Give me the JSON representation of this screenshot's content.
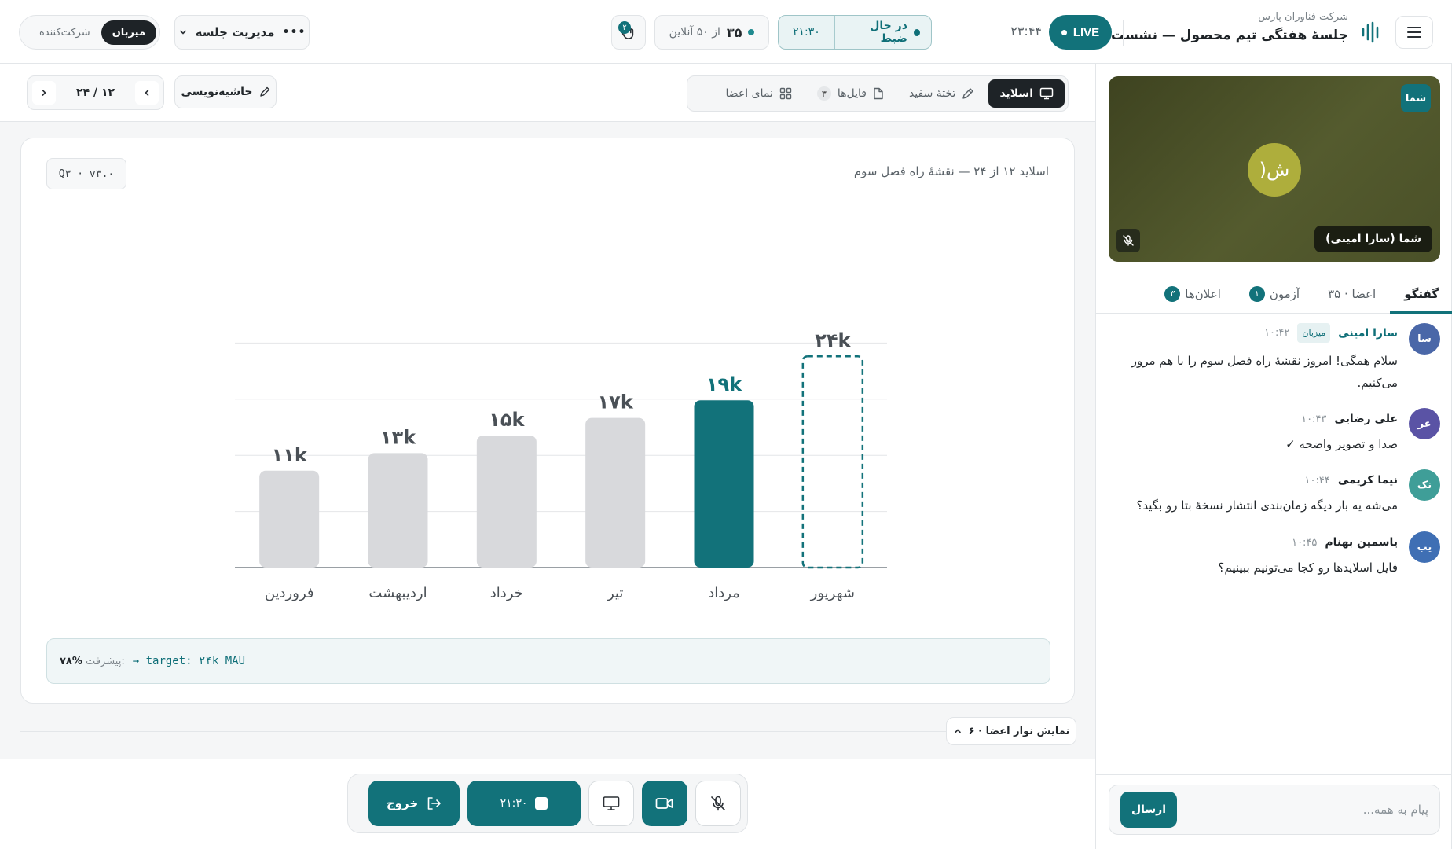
{
  "header": {
    "org": "شرکت فناوران پارس",
    "title": "جلسهٔ هفتگی تیم محصول — نشست ۸",
    "live_label": "LIVE",
    "clock": "۲۳:۴۴",
    "recording_label": "در حال ضبط",
    "recording_time": "۲۱:۳۰",
    "online_count": "۳۵",
    "online_suffix": "از ۵۰ آنلاین",
    "hand_count": "۲",
    "manage_label": "مدیریت جلسه",
    "role_active": "میزبان",
    "role_other": "شرکت‌کننده"
  },
  "toolbar": {
    "tabs": [
      {
        "label": "اسلاید",
        "icon": "monitor-icon",
        "active": true
      },
      {
        "label": "تختهٔ سفید",
        "icon": "pen-icon",
        "active": false
      },
      {
        "label": "فایل‌ها",
        "icon": "file-icon",
        "count": "۳",
        "active": false
      },
      {
        "label": "نمای اعضا",
        "icon": "grid-icon",
        "active": false
      }
    ],
    "annotate_label": "حاشیه‌نویسی",
    "page_indicator": "۱۲ / ۲۴"
  },
  "slide": {
    "caption": "اسلاید ۱۲ از ۲۴ — نقشهٔ راه فصل سوم",
    "version_tag": "Q۳ · v۳.۰",
    "progress_label": "پیشرفت:",
    "progress_value": "۷۸%",
    "code_text": "→ target: ۲۴k MAU"
  },
  "chart_data": {
    "type": "bar",
    "categories": [
      "فروردین",
      "اردیبهشت",
      "خرداد",
      "تیر",
      "مرداد",
      "شهریور"
    ],
    "values": [
      11,
      13,
      15,
      17,
      19,
      24
    ],
    "labels": [
      "۱۱k",
      "۱۳k",
      "۱۵k",
      "۱۷k",
      "۱۹k",
      "۲۴k"
    ],
    "highlight_index": 4,
    "target_index": 5,
    "ylim": [
      0,
      30
    ],
    "grid": true,
    "colors": {
      "bar": "#d8d9dc",
      "highlight": "#12727a",
      "label": "#4a5056",
      "target": "#12727a"
    }
  },
  "members_strip_label": "نمایش نوار اعضا · ۶",
  "controls": {
    "leave_label": "خروج",
    "record_time": "۲۱:۳۰"
  },
  "right_panel": {
    "video": {
      "you_badge": "شما",
      "avatar_initials": "ش(",
      "name": "شما (سارا امینی)"
    },
    "tabs": [
      {
        "label": "گفتگو",
        "active": true
      },
      {
        "label": "اعضا · ۳۵",
        "active": false
      },
      {
        "label": "آزمون",
        "badge": "۱",
        "active": false
      },
      {
        "label": "اعلان‌ها",
        "badge": "۳",
        "active": false
      }
    ],
    "messages": [
      {
        "initials": "سا",
        "name": "سارا امینی",
        "host_badge": "میزبان",
        "time": "۱۰:۴۲",
        "text": "سلام همگی! امروز نقشهٔ راه فصل سوم را با هم مرور می‌کنیم.",
        "color": "#4a67a8"
      },
      {
        "initials": "عر",
        "name": "علی رضایی",
        "time": "۱۰:۴۳",
        "text": "صدا و تصویر واضحه ✓",
        "color": "#5a53a5"
      },
      {
        "initials": "نک",
        "name": "نیما کریمی",
        "time": "۱۰:۴۴",
        "text": "می‌شه یه بار دیگه زمان‌بندی انتشار نسخهٔ بتا رو بگید؟",
        "color": "#3f9e98"
      },
      {
        "initials": "یب",
        "name": "یاسمین بهنام",
        "time": "۱۰:۴۵",
        "text": "فایل اسلایدها رو کجا می‌تونیم ببینیم؟",
        "color": "#3f6fb4"
      }
    ],
    "composer_placeholder": "پیام به همه...",
    "send_label": "ارسال"
  }
}
